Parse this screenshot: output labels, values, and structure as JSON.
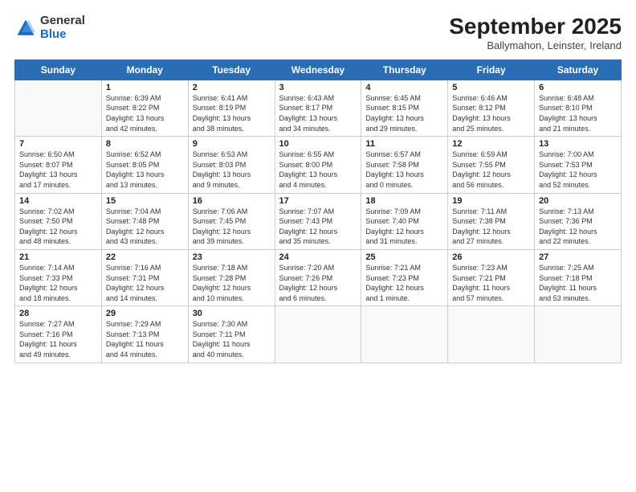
{
  "logo": {
    "general": "General",
    "blue": "Blue"
  },
  "title": "September 2025",
  "subtitle": "Ballymahon, Leinster, Ireland",
  "days_of_week": [
    "Sunday",
    "Monday",
    "Tuesday",
    "Wednesday",
    "Thursday",
    "Friday",
    "Saturday"
  ],
  "weeks": [
    [
      {
        "day": "",
        "info": ""
      },
      {
        "day": "1",
        "info": "Sunrise: 6:39 AM\nSunset: 8:22 PM\nDaylight: 13 hours\nand 42 minutes."
      },
      {
        "day": "2",
        "info": "Sunrise: 6:41 AM\nSunset: 8:19 PM\nDaylight: 13 hours\nand 38 minutes."
      },
      {
        "day": "3",
        "info": "Sunrise: 6:43 AM\nSunset: 8:17 PM\nDaylight: 13 hours\nand 34 minutes."
      },
      {
        "day": "4",
        "info": "Sunrise: 6:45 AM\nSunset: 8:15 PM\nDaylight: 13 hours\nand 29 minutes."
      },
      {
        "day": "5",
        "info": "Sunrise: 6:46 AM\nSunset: 8:12 PM\nDaylight: 13 hours\nand 25 minutes."
      },
      {
        "day": "6",
        "info": "Sunrise: 6:48 AM\nSunset: 8:10 PM\nDaylight: 13 hours\nand 21 minutes."
      }
    ],
    [
      {
        "day": "7",
        "info": "Sunrise: 6:50 AM\nSunset: 8:07 PM\nDaylight: 13 hours\nand 17 minutes."
      },
      {
        "day": "8",
        "info": "Sunrise: 6:52 AM\nSunset: 8:05 PM\nDaylight: 13 hours\nand 13 minutes."
      },
      {
        "day": "9",
        "info": "Sunrise: 6:53 AM\nSunset: 8:03 PM\nDaylight: 13 hours\nand 9 minutes."
      },
      {
        "day": "10",
        "info": "Sunrise: 6:55 AM\nSunset: 8:00 PM\nDaylight: 13 hours\nand 4 minutes."
      },
      {
        "day": "11",
        "info": "Sunrise: 6:57 AM\nSunset: 7:58 PM\nDaylight: 13 hours\nand 0 minutes."
      },
      {
        "day": "12",
        "info": "Sunrise: 6:59 AM\nSunset: 7:55 PM\nDaylight: 12 hours\nand 56 minutes."
      },
      {
        "day": "13",
        "info": "Sunrise: 7:00 AM\nSunset: 7:53 PM\nDaylight: 12 hours\nand 52 minutes."
      }
    ],
    [
      {
        "day": "14",
        "info": "Sunrise: 7:02 AM\nSunset: 7:50 PM\nDaylight: 12 hours\nand 48 minutes."
      },
      {
        "day": "15",
        "info": "Sunrise: 7:04 AM\nSunset: 7:48 PM\nDaylight: 12 hours\nand 43 minutes."
      },
      {
        "day": "16",
        "info": "Sunrise: 7:06 AM\nSunset: 7:45 PM\nDaylight: 12 hours\nand 39 minutes."
      },
      {
        "day": "17",
        "info": "Sunrise: 7:07 AM\nSunset: 7:43 PM\nDaylight: 12 hours\nand 35 minutes."
      },
      {
        "day": "18",
        "info": "Sunrise: 7:09 AM\nSunset: 7:40 PM\nDaylight: 12 hours\nand 31 minutes."
      },
      {
        "day": "19",
        "info": "Sunrise: 7:11 AM\nSunset: 7:38 PM\nDaylight: 12 hours\nand 27 minutes."
      },
      {
        "day": "20",
        "info": "Sunrise: 7:13 AM\nSunset: 7:36 PM\nDaylight: 12 hours\nand 22 minutes."
      }
    ],
    [
      {
        "day": "21",
        "info": "Sunrise: 7:14 AM\nSunset: 7:33 PM\nDaylight: 12 hours\nand 18 minutes."
      },
      {
        "day": "22",
        "info": "Sunrise: 7:16 AM\nSunset: 7:31 PM\nDaylight: 12 hours\nand 14 minutes."
      },
      {
        "day": "23",
        "info": "Sunrise: 7:18 AM\nSunset: 7:28 PM\nDaylight: 12 hours\nand 10 minutes."
      },
      {
        "day": "24",
        "info": "Sunrise: 7:20 AM\nSunset: 7:26 PM\nDaylight: 12 hours\nand 6 minutes."
      },
      {
        "day": "25",
        "info": "Sunrise: 7:21 AM\nSunset: 7:23 PM\nDaylight: 12 hours\nand 1 minute."
      },
      {
        "day": "26",
        "info": "Sunrise: 7:23 AM\nSunset: 7:21 PM\nDaylight: 11 hours\nand 57 minutes."
      },
      {
        "day": "27",
        "info": "Sunrise: 7:25 AM\nSunset: 7:18 PM\nDaylight: 11 hours\nand 53 minutes."
      }
    ],
    [
      {
        "day": "28",
        "info": "Sunrise: 7:27 AM\nSunset: 7:16 PM\nDaylight: 11 hours\nand 49 minutes."
      },
      {
        "day": "29",
        "info": "Sunrise: 7:29 AM\nSunset: 7:13 PM\nDaylight: 11 hours\nand 44 minutes."
      },
      {
        "day": "30",
        "info": "Sunrise: 7:30 AM\nSunset: 7:11 PM\nDaylight: 11 hours\nand 40 minutes."
      },
      {
        "day": "",
        "info": ""
      },
      {
        "day": "",
        "info": ""
      },
      {
        "day": "",
        "info": ""
      },
      {
        "day": "",
        "info": ""
      }
    ]
  ]
}
